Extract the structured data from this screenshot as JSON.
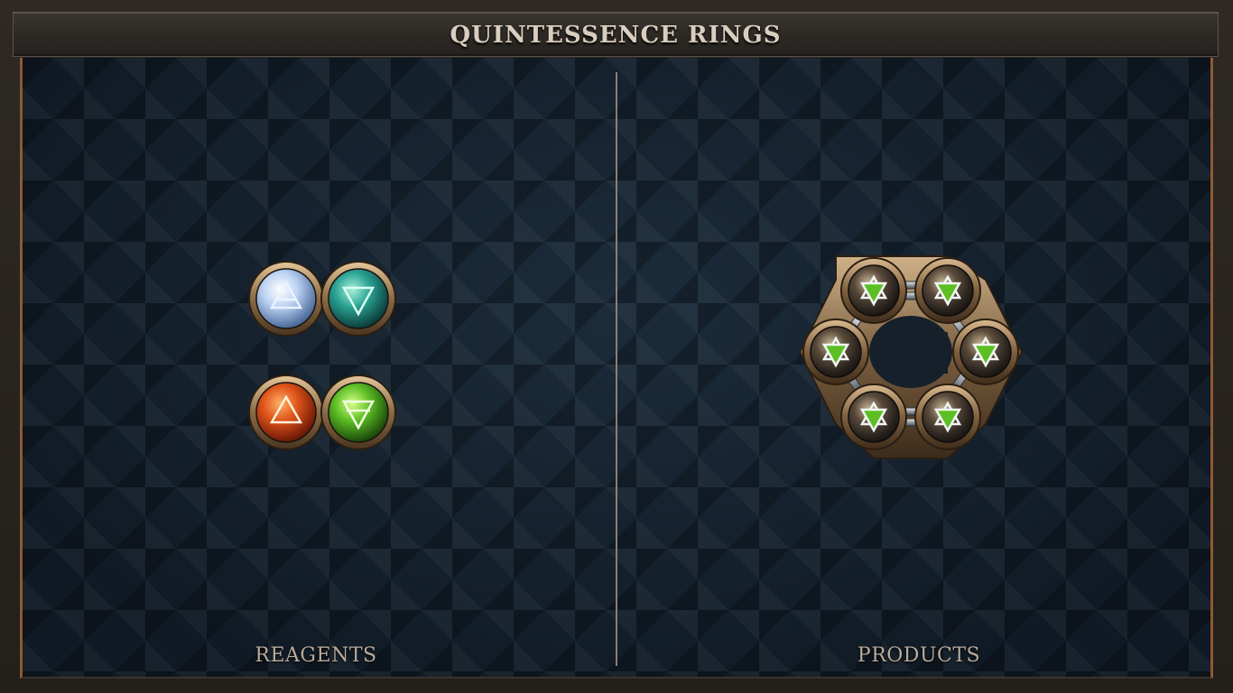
{
  "window": {
    "title": "QUINTESSENCE RINGS"
  },
  "panels": {
    "reagents": {
      "label": "REAGENTS"
    },
    "products": {
      "label": "PRODUCTS"
    }
  },
  "reagents": [
    {
      "pair": [
        {
          "element": "air",
          "glyph": "air-triangle-icon",
          "color": "#cfe3ff"
        },
        {
          "element": "water",
          "glyph": "water-triangle-icon",
          "color": "#2aa394"
        }
      ]
    },
    {
      "pair": [
        {
          "element": "fire",
          "glyph": "fire-triangle-icon",
          "color": "#e0541a"
        },
        {
          "element": "earth",
          "glyph": "earth-triangle-icon",
          "color": "#5dbf25"
        }
      ]
    }
  ],
  "product": {
    "shape": "hexagonal-ring",
    "atoms": 6,
    "glyph": "quintessence-star-icon",
    "color": "#3a3530"
  },
  "colors": {
    "frame_copper": "#8b5a33",
    "board": "#14202c",
    "label_text": "#b8ab9c"
  }
}
